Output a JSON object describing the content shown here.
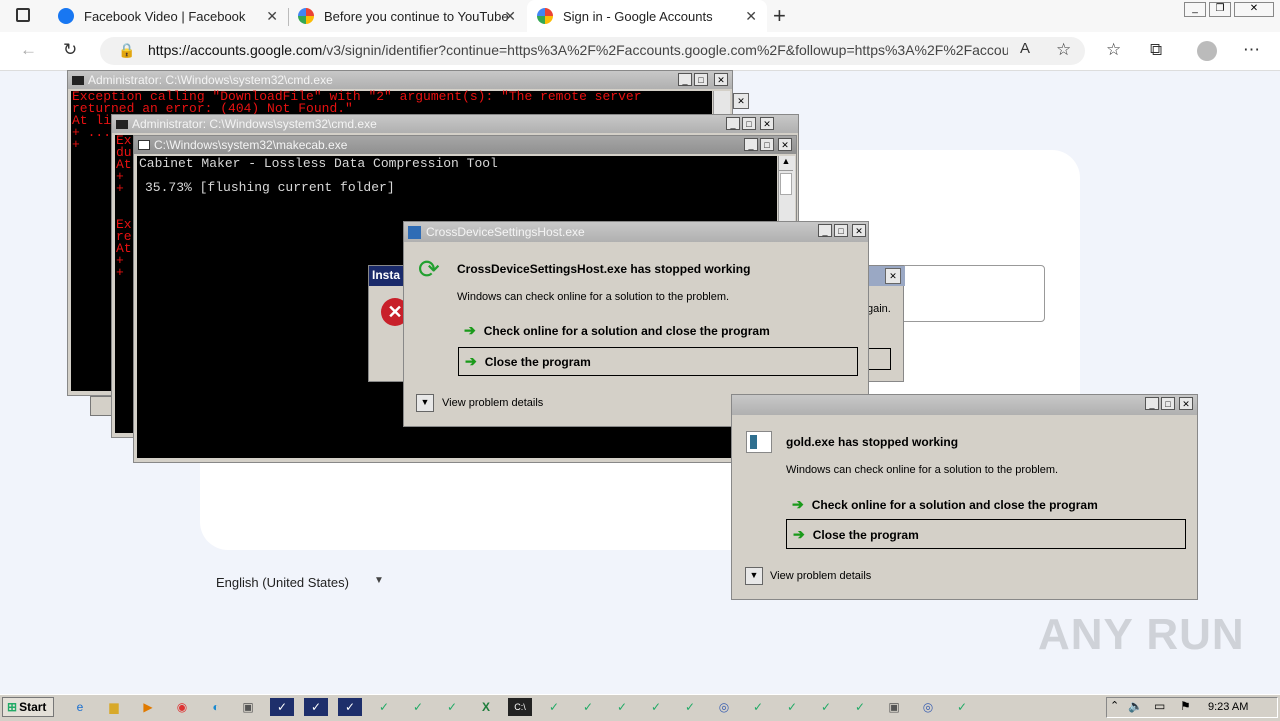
{
  "browser": {
    "tabs": [
      {
        "label": "Facebook Video | Facebook",
        "icon": "facebook-icon"
      },
      {
        "label": "Before you continue to YouTube",
        "icon": "google-icon"
      },
      {
        "label": "Sign in - Google Accounts",
        "icon": "google-icon"
      }
    ],
    "url_host": "https://accounts.google.com",
    "url_rest": "/v3/signin/identifier?continue=https%3A%2F%2Faccounts.google.com%2F&followup=https%3A%2F%2Faccou..."
  },
  "google_page": {
    "language": "English (United States)"
  },
  "cmd1": {
    "title": "Administrator: C:\\Windows\\system32\\cmd.exe",
    "lines": [
      "Exception calling \"DownloadFile\" with \"2\" argument(s): \"The remote server",
      "returned an error: (404) Not Found.\"",
      "At li",
      "+ ...",
      "+"
    ]
  },
  "cmd2": {
    "title": "Administrator: C:\\Windows\\system32\\cmd.exe",
    "lines": [
      "Ex",
      "du",
      "At",
      "+",
      "+",
      "",
      "",
      "Ex",
      "re",
      "At",
      "+",
      "+"
    ]
  },
  "makecab": {
    "title": "C:\\Windows\\system32\\makecab.exe",
    "header": "Cabinet Maker - Lossless Data Compression Tool",
    "progress": "35.73% [flushing current folder]"
  },
  "install_dialog": {
    "title": "Insta",
    "text": "gain."
  },
  "crossdevice": {
    "title": "CrossDeviceSettingsHost.exe",
    "heading": "CrossDeviceSettingsHost.exe has stopped working",
    "message": "Windows can check online for a solution to the problem.",
    "option1": "Check online for a solution and close the program",
    "option2": "Close the program",
    "details": "View problem details"
  },
  "gold": {
    "heading": "gold.exe has stopped working",
    "message": "Windows can check online for a solution to the problem.",
    "option1": "Check online for a solution and close the program",
    "option2": "Close the program",
    "details": "View problem details"
  },
  "taskbar": {
    "start": "Start",
    "clock": "9:23 AM"
  },
  "watermark": "ANY RUN"
}
